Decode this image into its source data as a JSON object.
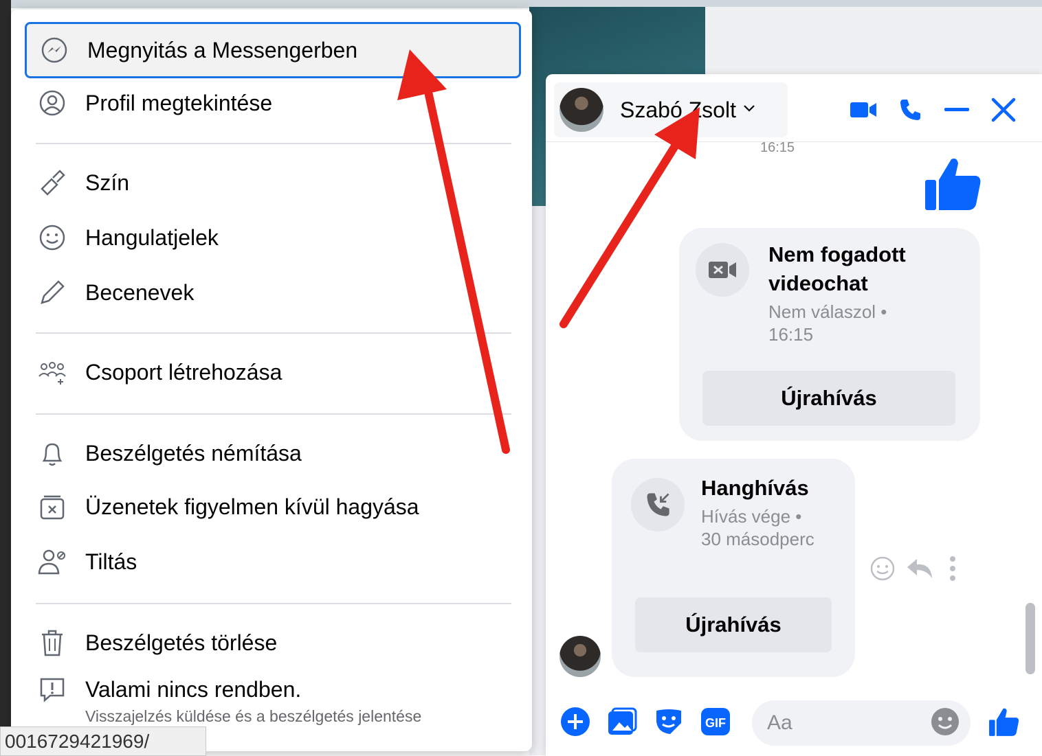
{
  "menu": {
    "items": [
      {
        "label": "Megnyitás a Messengerben",
        "icon": "messenger-icon"
      },
      {
        "label": "Profil megtekintése",
        "icon": "profile-icon"
      },
      {
        "label": "Szín",
        "icon": "paint-brush-icon"
      },
      {
        "label": "Hangulatjelek",
        "icon": "smiley-icon"
      },
      {
        "label": "Becenevek",
        "icon": "pencil-icon"
      },
      {
        "label": "Csoport létrehozása",
        "icon": "group-add-icon"
      },
      {
        "label": "Beszélgetés némítása",
        "icon": "bell-icon"
      },
      {
        "label": "Üzenetek figyelmen kívül hagyása",
        "icon": "ignore-messages-icon"
      },
      {
        "label": "Tiltás",
        "icon": "block-user-icon"
      },
      {
        "label": "Beszélgetés törlése",
        "icon": "trash-icon"
      },
      {
        "label": "Valami nincs rendben.",
        "sublabel": "Visszajelzés küldése és a beszélgetés jelentése",
        "icon": "report-icon"
      }
    ]
  },
  "status_url": "0016729421969/",
  "chat": {
    "contact_name": "Szabó Zsolt",
    "timestamp": "16:15",
    "missed_video": {
      "title": "Nem fogadott videochat",
      "subtitle": "Nem válaszol • 16:15",
      "button": "Újrahívás"
    },
    "voice_call": {
      "title": "Hanghívás",
      "subtitle": "Hívás vége • 30 másodperc",
      "button": "Újrahívás"
    },
    "composer_placeholder": "Aa"
  },
  "colors": {
    "accent": "#0866ff",
    "arrow": "#e8231c",
    "focus": "#1b74e4"
  }
}
